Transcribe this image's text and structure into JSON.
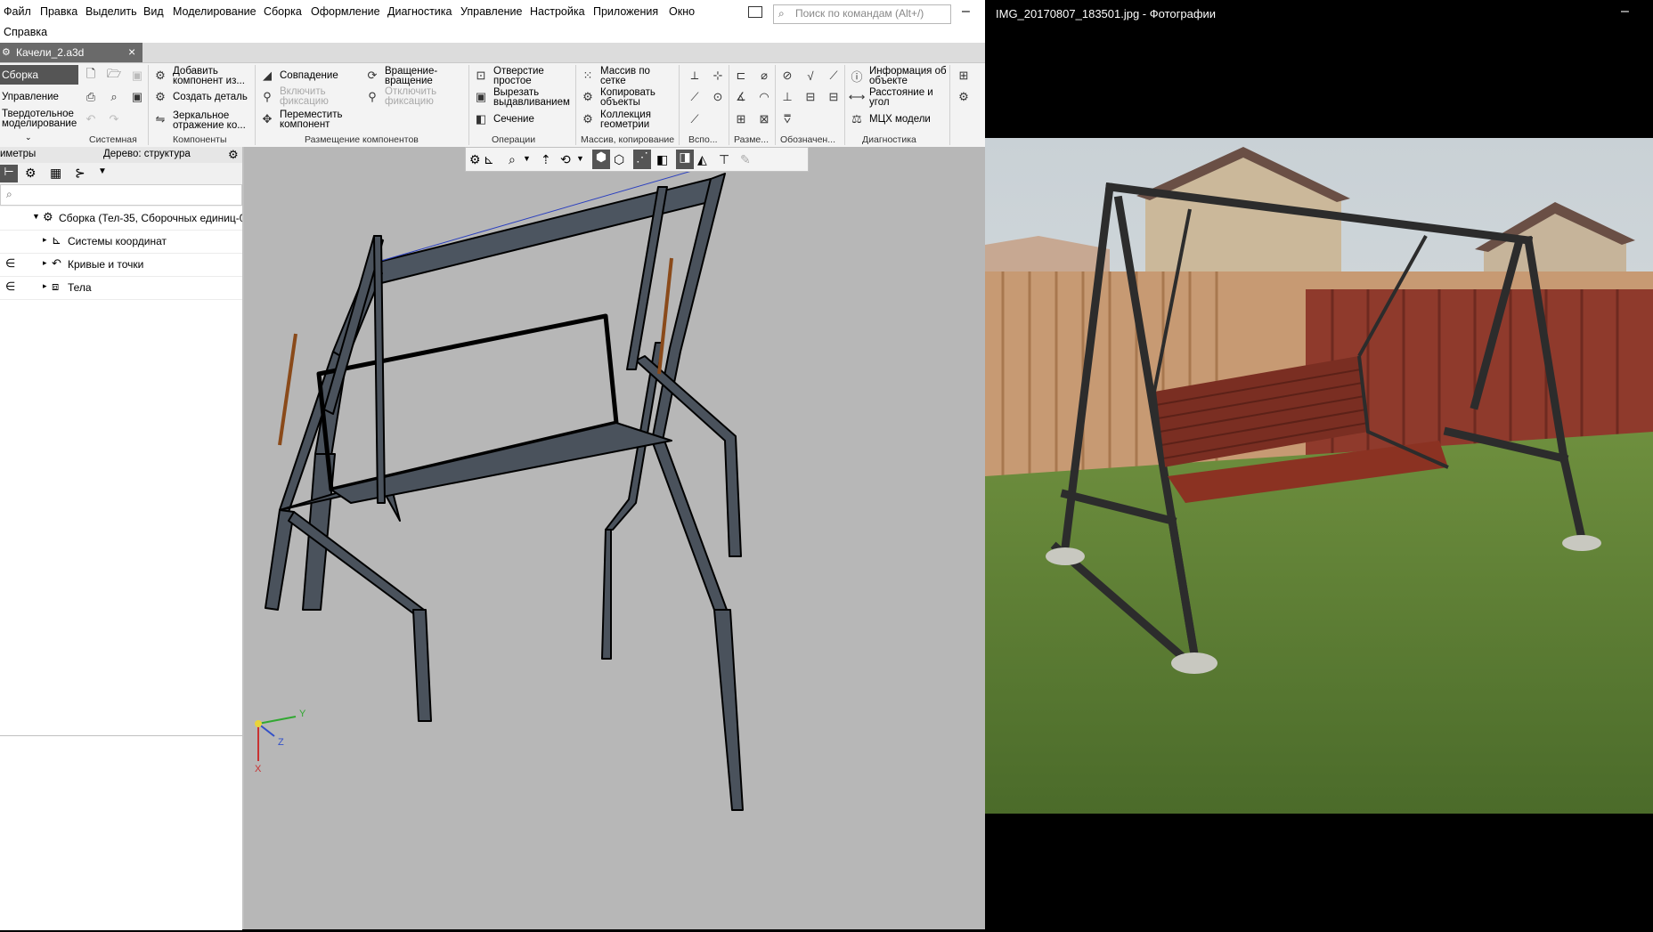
{
  "menu": [
    "Файл",
    "Правка",
    "Выделить",
    "Вид",
    "Моделирование",
    "Сборка",
    "Оформление",
    "Диагностика",
    "Управление",
    "Настройка",
    "Приложения",
    "Окно",
    "Справка"
  ],
  "search": {
    "placeholder": "Поиск по командам (Alt+/)"
  },
  "doc_tab": {
    "title": "Качели_2.a3d",
    "close": "×"
  },
  "left_nav": {
    "items": [
      "Сборка",
      "Управление",
      "Твердотельное моделирование"
    ]
  },
  "ribbon": {
    "components": {
      "add": "Добавить компонент из...",
      "create": "Создать деталь",
      "mirror": "Зеркальное отражение ко..."
    },
    "placement": {
      "coincidence": "Совпадение",
      "enable_fix": "Включить фиксацию",
      "move": "Переместить компонент",
      "rotation": "Вращение-вращение",
      "disable_fix": "Отключить фиксацию"
    },
    "operations": {
      "hole": "Отверстие простое",
      "cut": "Вырезать выдавливанием",
      "section": "Сечение"
    },
    "array": {
      "grid": "Массив по сетке",
      "copy": "Копировать объекты",
      "collection": "Коллекция геометрии"
    },
    "diagnostics": {
      "info": "Информация об объекте",
      "distance": "Расстояние и угол",
      "mch": "МЦХ модели"
    },
    "groups": [
      "Системная",
      "Компоненты",
      "Размещение компонентов",
      "Операции",
      "Массив, копирование",
      "Вспо...",
      "Разме...",
      "Обозначен...",
      "Диагностика"
    ]
  },
  "panel": {
    "params_label": "иметры",
    "tree_label": "Дерево: структура"
  },
  "tree": {
    "root": "Сборка (Тел-35, Сборочных единиц-0",
    "items": [
      "Системы координат",
      "Кривые и точки",
      "Тела"
    ]
  },
  "axes": {
    "x": "X",
    "y": "Y",
    "z": "Z"
  },
  "photo_viewer": {
    "title": "IMG_20170807_183501.jpg - Фотографии",
    "minimize": "–"
  },
  "window_controls": {
    "minimize": "–"
  }
}
